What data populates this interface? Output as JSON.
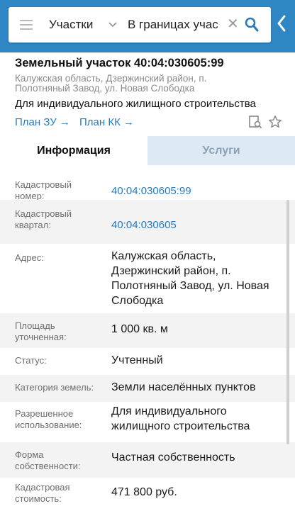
{
  "search": {
    "type_label": "Участки",
    "query": "В границах учас"
  },
  "header": {
    "title": "Земельный участок 40:04:030605:99",
    "address": "Калужская область, Дзержинский район, п. Полотняный Завод, ул. Новая Слободка",
    "purpose": "Для индивидуального жилищного строительства",
    "link_plan_zu": "План ЗУ →",
    "link_plan_kk": "План КК →"
  },
  "tabs": {
    "info": "Информация",
    "services": "Услуги"
  },
  "details": [
    {
      "label": "Кадастровый номер:",
      "value": "40:04:030605:99"
    },
    {
      "label": "Кадастровый квартал:",
      "value": "40:04:030605"
    },
    {
      "label": "Адрес:",
      "value": "Калужская область, Дзержинский район, п. Полотняный Завод, ул. Новая Слободка"
    },
    {
      "label": "Площадь уточненная:",
      "value": "1 000 кв. м"
    },
    {
      "label": "Статус:",
      "value": "Учтенный"
    },
    {
      "label": "Категория земель:",
      "value": "Земли населённых пунктов"
    },
    {
      "label": "Разрешенное использование:",
      "value": "Для индивидуального жилищного строительства"
    },
    {
      "label": "Форма собственности:",
      "value": "Частная собственность"
    },
    {
      "label": "Кадастровая стоимость:",
      "value": "471 800 руб."
    }
  ]
}
